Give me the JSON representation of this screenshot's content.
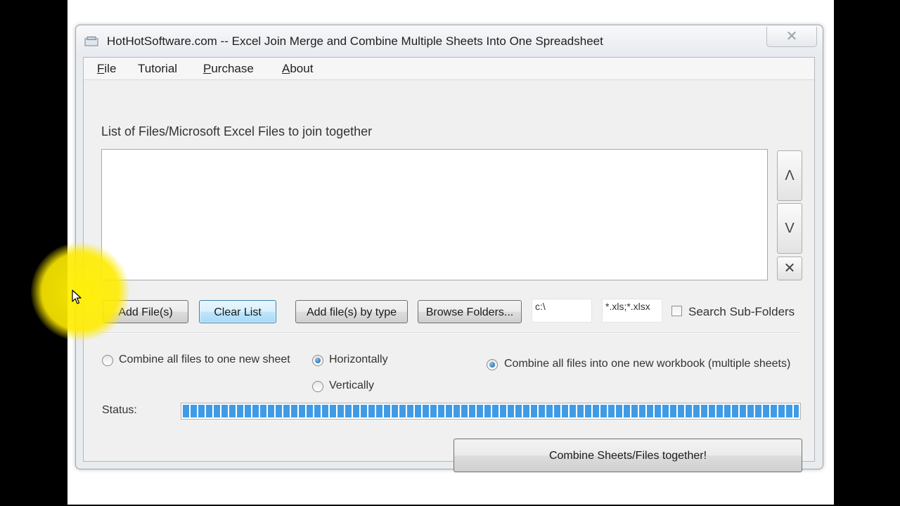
{
  "window": {
    "title": "HotHotSoftware.com -- Excel Join Merge and Combine Multiple Sheets Into One Spreadsheet",
    "close_glyph": "✕"
  },
  "menu": {
    "file_first": "F",
    "file_rest": "ile",
    "tutorial": "Tutorial",
    "purchase_first": "P",
    "purchase_rest": "urchase",
    "about_first": "A",
    "about_rest": "bout"
  },
  "file_list": {
    "label": "List of Files/Microsoft Excel Files to join together",
    "items": []
  },
  "side_buttons": {
    "up": "Λ",
    "down": "V",
    "remove": "✕"
  },
  "buttons": {
    "add_files": "Add File(s)",
    "clear_list": "Clear List",
    "add_by_type": "Add file(s) by type",
    "browse_folders": "Browse Folders...",
    "combine": "Combine Sheets/Files together!"
  },
  "inputs": {
    "folder_path": "c:\\",
    "file_types": "*.xls;*.xlsx"
  },
  "options": {
    "search_subfolders": {
      "label": "Search Sub-Folders",
      "checked": false
    },
    "combine_one_sheet": {
      "label": "Combine all files to one new sheet",
      "selected": false
    },
    "horizontally": {
      "label": "Horizontally",
      "selected": true
    },
    "vertically": {
      "label": "Vertically",
      "selected": false
    },
    "combine_workbook": {
      "label": "Combine all files into one new workbook (multiple sheets)",
      "selected": true
    }
  },
  "status": {
    "label": "Status:",
    "progress": 1.0
  },
  "colors": {
    "progress": "#3f9be6",
    "highlight": "#ffeb00"
  }
}
